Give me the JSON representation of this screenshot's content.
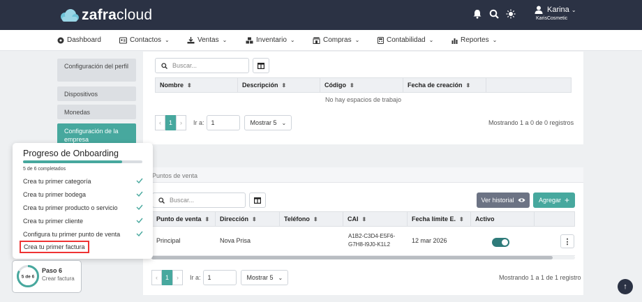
{
  "brand": {
    "name_bold": "zafra",
    "name_light": "cloud"
  },
  "user": {
    "name": "Karina",
    "org": "KarisCosmetic"
  },
  "nav": [
    {
      "label": "Dashboard",
      "icon": "dashboard-icon"
    },
    {
      "label": "Contactos",
      "icon": "contacts-icon"
    },
    {
      "label": "Ventas",
      "icon": "sales-icon"
    },
    {
      "label": "Inventario",
      "icon": "inventory-icon"
    },
    {
      "label": "Compras",
      "icon": "purchases-icon"
    },
    {
      "label": "Contabilidad",
      "icon": "accounting-icon"
    },
    {
      "label": "Reportes",
      "icon": "reports-icon"
    }
  ],
  "sidebar": [
    {
      "label": "Configuración del perfil"
    },
    {
      "label": "Dispositivos"
    },
    {
      "label": "Monedas"
    },
    {
      "label": "Configuración de la empresa"
    }
  ],
  "workspaces": {
    "search_placeholder": "Buscar...",
    "columns": [
      "Nombre",
      "Descripción",
      "Código",
      "Fecha de creación"
    ],
    "empty_text": "No hay espacios de trabajo",
    "pager": {
      "page": "1",
      "goto_label": "Ir a:",
      "goto_value": "1",
      "show": "Mostrar 5"
    },
    "info": "Mostrando 1 a 0 de 0 registros"
  },
  "pos": {
    "title": "Puntos de venta",
    "search_placeholder": "Buscar...",
    "history_button": "Ver historial",
    "add_button": "Agregar",
    "columns": [
      "Punto de venta",
      "Dirección",
      "Teléfono",
      "CAI",
      "Fecha límite E.",
      "Activo"
    ],
    "rows": [
      {
        "name": "Principal",
        "address": "Nova Prisa",
        "phone": "",
        "cai_1": "A1B2-C3D4-E5F6-",
        "cai_2": "G7H8-I9J0-K1L2",
        "deadline": "12 mar 2026",
        "active": true
      }
    ],
    "pager": {
      "page": "1",
      "goto_label": "Ir a:",
      "goto_value": "1",
      "show": "Mostrar 5"
    },
    "info": "Mostrando 1 a 1 de 1 registro"
  },
  "onboarding": {
    "title": "Progreso de Onboarding",
    "progress_count": "5 de 6 completados",
    "progress": 0.8333,
    "tasks": [
      {
        "label": "Crea tu primer categoría",
        "done": true
      },
      {
        "label": "Crea tu primer bodega",
        "done": true
      },
      {
        "label": "Crea tu primer producto o servicio",
        "done": true
      },
      {
        "label": "Crea tu primer cliente",
        "done": true
      },
      {
        "label": "Configura tu primer punto de venta",
        "done": true
      },
      {
        "label": "Crea tu primer factura",
        "done": false
      }
    ]
  },
  "step": {
    "ring_text": "5 de 6",
    "label": "Paso 6",
    "sub": "Crear factura"
  },
  "colors": {
    "accent": "#47a89e",
    "topbar": "#2b3244",
    "highlight": "#e33333"
  }
}
